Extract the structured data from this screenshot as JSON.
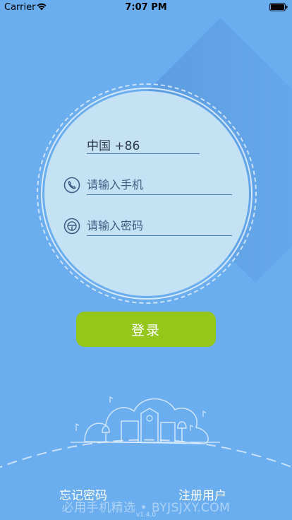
{
  "status_bar": {
    "carrier": "Carrier",
    "time": "7:07 PM"
  },
  "login_form": {
    "country_code": "中国 +86",
    "phone_placeholder": "请输入手机",
    "password_placeholder": "请输入密码",
    "login_label": "登录"
  },
  "footer": {
    "forgot_password": "忘记密码",
    "register": "注册用户",
    "watermark": "必用手机精选 • BYJSJXY.COM",
    "version": "v1.4.0"
  },
  "colors": {
    "background": "#6aaef0",
    "card": "#c5e2f4",
    "login_button": "#95c61a",
    "field_line": "#4a7fb6"
  },
  "icons": [
    "wifi-icon",
    "battery-icon",
    "phone-icon",
    "lock-icon"
  ]
}
